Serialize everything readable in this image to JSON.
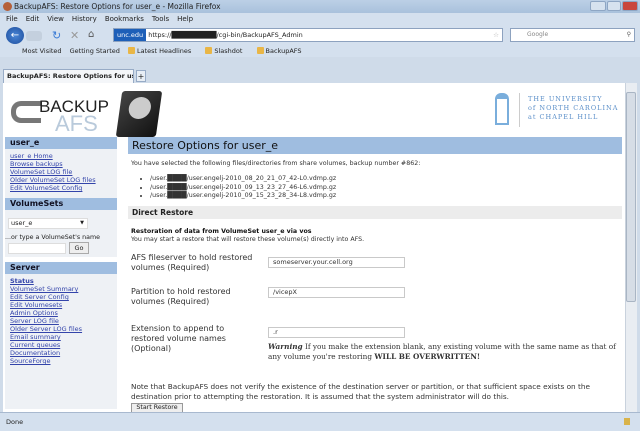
{
  "window": {
    "title": "BackupAFS: Restore Options for user_e - Mozilla Firefox"
  },
  "menu": [
    "File",
    "Edit",
    "View",
    "History",
    "Bookmarks",
    "Tools",
    "Help"
  ],
  "nav": {
    "identity": "unc.edu",
    "url": "https://█████████/cgi-bin/BackupAFS_Admin",
    "search_placeholder": "Google"
  },
  "bookmarks": [
    "Most Visited",
    "Getting Started",
    "Latest Headlines",
    "Slashdot",
    "BackupAFS"
  ],
  "tab": {
    "label": "BackupAFS: Restore Options for user_e",
    "new_tab": "+"
  },
  "logo": {
    "line1": "BACKUP",
    "line2": "AFS"
  },
  "unc": {
    "line1": "THE UNIVERSITY",
    "line2": "of NORTH CAROLINA",
    "line3": "at CHAPEL HILL"
  },
  "sidebar": {
    "user_header": "user_e",
    "user_links": [
      "user_e Home",
      "Browse backups",
      "VolumeSet LOG file",
      "Older VolumeSet LOG files",
      "Edit VolumeSet Config"
    ],
    "volumesets_header": "VolumeSets",
    "volumeset_selected": "user_e",
    "type_hint": "...or type a VolumeSet's name",
    "go_label": "Go",
    "server_header": "Server",
    "server_links": [
      "Status",
      "VolumeSet Summary",
      "Edit Server Config",
      "Edit Volumesets",
      "Admin Options",
      "Server LOG file",
      "Older Server LOG files",
      "Email summary",
      "Current queues",
      "Documentation",
      "SourceForge"
    ]
  },
  "main": {
    "title": "Restore Options for user_e",
    "intro": "You have selected the following files/directories from share volumes, backup number #862:",
    "files": [
      "/user.████/user.engelj-2010_08_20_21_07_42-L0.vdmp.gz",
      "/user.████/user.engelj-2010_09_13_23_27_46-L6.vdmp.gz",
      "/user.████/user.engelj-2010_09_15_23_28_34-L8.vdmp.gz"
    ],
    "section": "Direct Restore",
    "sub_bold": "Restoration of data from VolumeSet user_e via vos",
    "sub_text": "You may start a restore that will restore these volume(s) directly into AFS.",
    "fields": [
      {
        "label": "AFS fileserver to hold restored volumes (Required)",
        "value": "someserver.your.cell.org"
      },
      {
        "label": "Partition to hold restored volumes (Required)",
        "value": "/vicepX"
      },
      {
        "label": "Extension to append to restored volume names (Optional)",
        "value": ".r"
      }
    ],
    "warning_label": "Warning",
    "warning_text": " If you make the extension blank, any existing volume with the same name as that of any volume you're restoring ",
    "warning_bold": "WILL BE OVERWRITTEN!",
    "note": "Note that BackupAFS does not verify the existence of the destination server or partition, or that sufficient space exists on the destination prior to attempting the restoration. It is assumed that the system administrator will do this.",
    "start_button": "Start Restore"
  },
  "status": "Done"
}
